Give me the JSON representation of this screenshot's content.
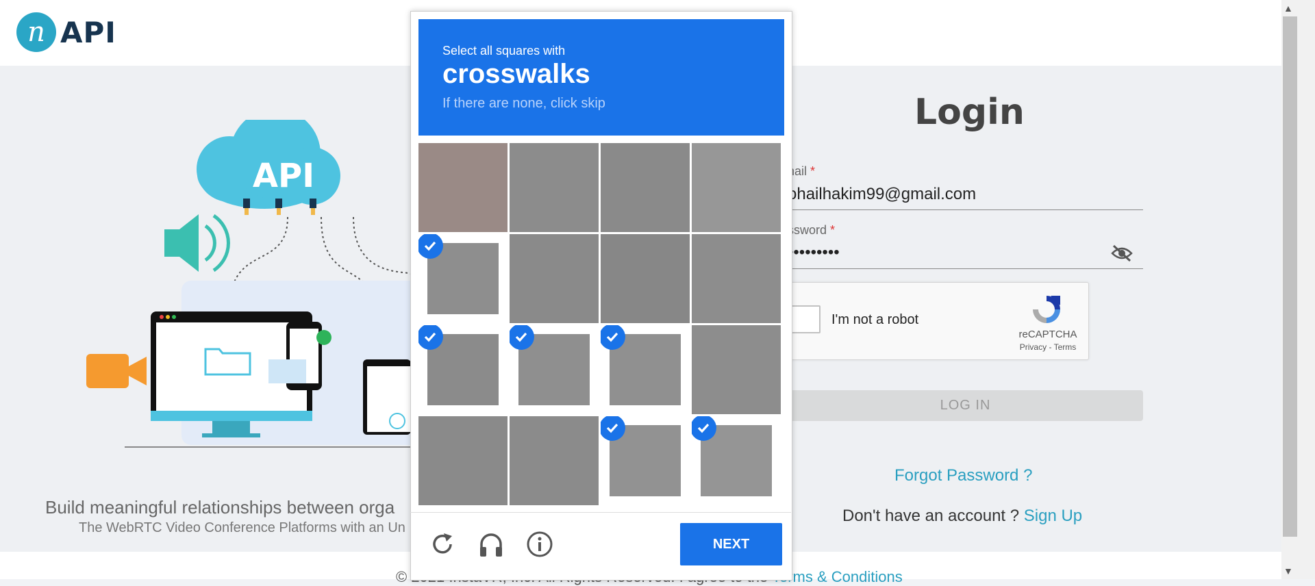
{
  "header": {
    "logo_mark": "n",
    "logo_text": "API"
  },
  "hero": {
    "cloud_label": "API",
    "tagline": "Build meaningful relationships between orga",
    "subtagline": "The WebRTC Video Conference Platforms with an Un"
  },
  "login": {
    "title": "Login",
    "email_label": "nail",
    "email_value": "ohailhakim99@gmail.com",
    "password_label": "ssword",
    "password_value": "•••••••••",
    "required_mark": "*",
    "button": "LOG IN",
    "forgot": "Forgot Password ?",
    "no_account": "Don't have an account ?",
    "signup": "Sign Up"
  },
  "recaptcha": {
    "label": "I'm not a robot",
    "brand": "reCAPTCHA",
    "privacy": "Privacy",
    "sep": " - ",
    "terms": "Terms"
  },
  "challenge": {
    "instruction": "Select all squares with",
    "object": "crosswalks",
    "hint": "If there are none, click skip",
    "next": "NEXT",
    "selected": [
      [
        false,
        false,
        false,
        false
      ],
      [
        true,
        false,
        false,
        false
      ],
      [
        true,
        true,
        true,
        false
      ],
      [
        false,
        false,
        true,
        true
      ]
    ]
  },
  "footer": {
    "text": "© 2021 InstaVR, Inc. All Rights Reserved. I agree to the",
    "link": "Terms & Conditions"
  },
  "colors": {
    "accent": "#1a73e8",
    "brand": "#2aa6c6",
    "link": "#2a9fc0"
  }
}
